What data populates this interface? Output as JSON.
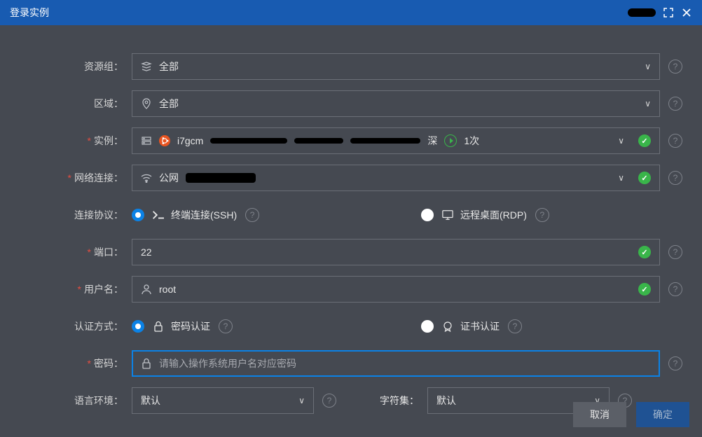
{
  "titlebar": {
    "title": "登录实例"
  },
  "form": {
    "resourceGroup": {
      "label": "资源组：",
      "value": "全部"
    },
    "region": {
      "label": "区域：",
      "value": "全部"
    },
    "instance": {
      "label": "实例：",
      "prefix": "i7gcm",
      "suffix": "深",
      "countLabel": "1次"
    },
    "network": {
      "label": "网络连接：",
      "value": "公网"
    },
    "protocol": {
      "label": "连接协议：",
      "ssh": "终端连接(SSH)",
      "rdp": "远程桌面(RDP)"
    },
    "port": {
      "label": "端口：",
      "value": "22"
    },
    "username": {
      "label": "用户名：",
      "value": "root"
    },
    "authMethod": {
      "label": "认证方式：",
      "password": "密码认证",
      "cert": "证书认证"
    },
    "password": {
      "label": "密码：",
      "placeholder": "请输入操作系统用户名对应密码"
    },
    "locale": {
      "label": "语言环境：",
      "value": "默认"
    },
    "charset": {
      "label": "字符集：",
      "value": "默认"
    }
  },
  "footer": {
    "cancel": "取消",
    "confirm": "确定"
  }
}
